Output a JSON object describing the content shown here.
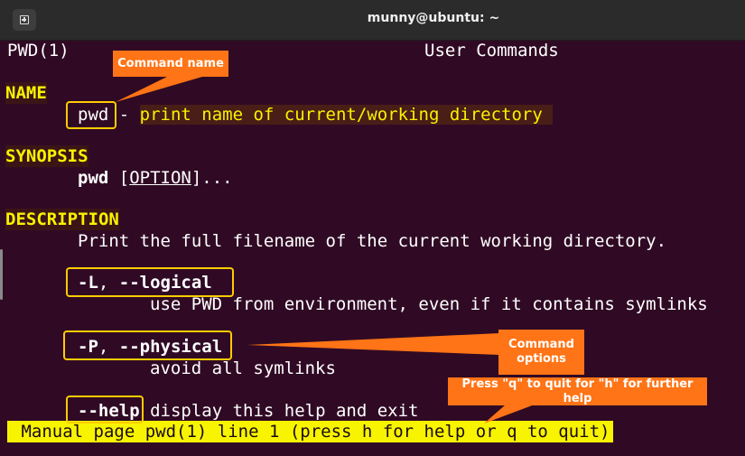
{
  "window": {
    "title": "munny@ubuntu: ~",
    "new_tab_icon": "new-tab-icon"
  },
  "man": {
    "header_left": "PWD(1)",
    "header_center": "User Commands",
    "name_heading": "NAME",
    "name_cmd": "pwd",
    "name_dash": " - ",
    "name_desc": "print name of current/working directory ",
    "synopsis_heading": "SYNOPSIS",
    "synopsis_cmd": "pwd",
    "synopsis_open": " [",
    "synopsis_option": "OPTION",
    "synopsis_close": "]...",
    "description_heading": "DESCRIPTION",
    "description_text": "Print the full filename of the current working directory.",
    "opt1_short": "-L",
    "opt1_sep": ", ",
    "opt1_long": "--logical",
    "opt1_desc": "use PWD from environment, even if it contains symlinks",
    "opt2_short": "-P",
    "opt2_sep": ", ",
    "opt2_long": "--physical",
    "opt2_desc": "avoid all symlinks",
    "opt3_long": "--help",
    "opt3_desc": " display this help and exit",
    "status": " Manual page pwd(1) line 1 (press h for help or q to quit)"
  },
  "annotations": {
    "command_name": "Command name",
    "command_options": "Command\noptions",
    "quit_help": "Press \"q\" to quit for \"h\" for further help",
    "callout_color": "#ff7416",
    "box_color": "#ffcc00"
  }
}
